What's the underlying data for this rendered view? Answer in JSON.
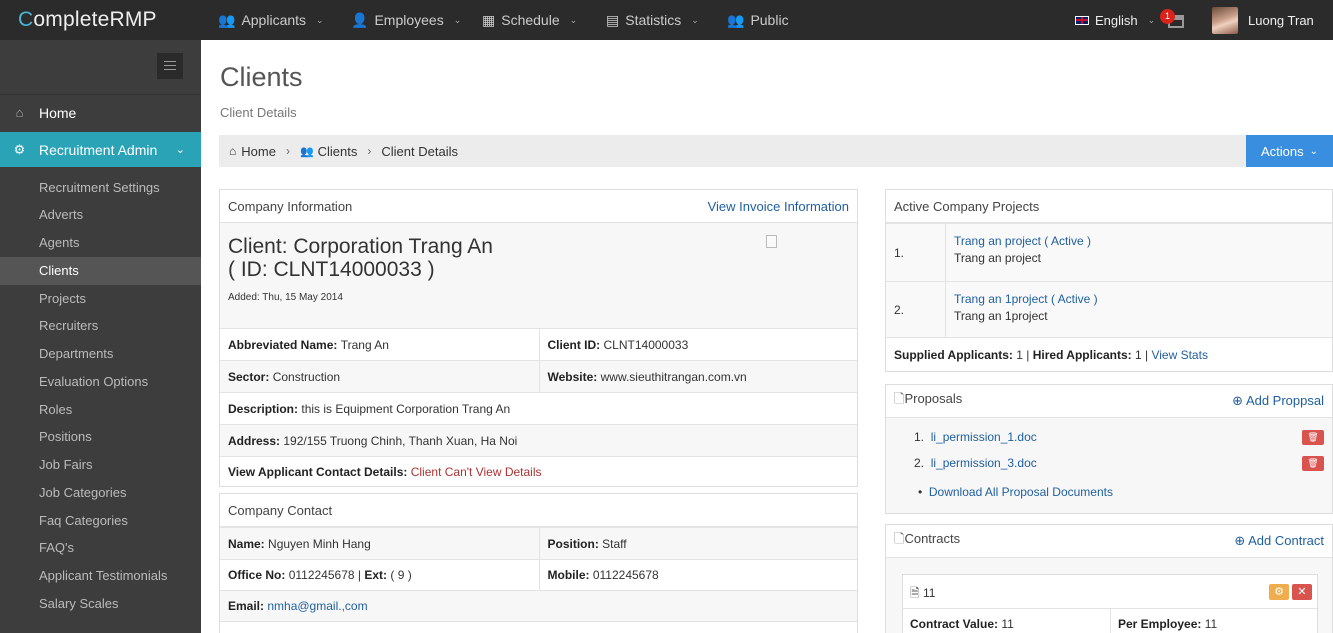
{
  "topbar": {
    "logo_prefix": "C",
    "logo_rest": "ompleteRMP",
    "nav": [
      "Applicants",
      "Employees",
      "Schedule",
      "Statistics",
      "Public"
    ],
    "language": "English",
    "notification_count": "1",
    "user_name": "Luong Tran"
  },
  "sidebar": {
    "home": "Home",
    "recruitment_admin": "Recruitment Admin",
    "items": [
      "Recruitment Settings",
      "Adverts",
      "Agents",
      "Clients",
      "Projects",
      "Recruiters",
      "Departments",
      "Evaluation Options",
      "Roles",
      "Positions",
      "Job Fairs",
      "Job Categories",
      "Faq Categories",
      "FAQ's",
      "Applicant Testimonials",
      "Salary Scales"
    ]
  },
  "page": {
    "title": "Clients",
    "subtitle": "Client Details",
    "breadcrumb": [
      "Home",
      "Clients",
      "Client Details"
    ],
    "actions": "Actions"
  },
  "company": {
    "header": "Company Information",
    "invoice_link": "View Invoice Information",
    "client_line1": "Client: Corporation Trang An",
    "client_line2": "( ID: CLNT14000033 )",
    "added": "Added: Thu, 15 May 2014",
    "abbr_label": "Abbreviated Name:",
    "abbr_value": "Trang An",
    "client_id_label": "Client ID:",
    "client_id_value": "CLNT14000033",
    "sector_label": "Sector:",
    "sector_value": "Construction",
    "website_label": "Website:",
    "website_value": "www.sieuthitrangan.com.vn",
    "desc_label": "Description:",
    "desc_value": "this is Equipment Corporation Trang An",
    "address_label": "Address:",
    "address_value": "192/155 Truong Chinh, Thanh Xuan, Ha Noi",
    "contact_details_label": "View Applicant Contact Details:",
    "contact_details_value": "Client Can't View Details"
  },
  "contact": {
    "header": "Company Contact",
    "name_label": "Name:",
    "name_value": "Nguyen Minh Hang",
    "position_label": "Position:",
    "position_value": "Staff",
    "office_label": "Office No:",
    "office_value": "0112245678",
    "ext_label": "Ext:",
    "ext_value": "( 9 )",
    "mobile_label": "Mobile:",
    "mobile_value": "0112245678",
    "email_label": "Email:",
    "email_value": "nmha@gmail.,com"
  },
  "projects": {
    "header": "Active Company Projects",
    "list": [
      {
        "num": "1.",
        "link": "Trang an project ( Active )",
        "name": "Trang an project"
      },
      {
        "num": "2.",
        "link": "Trang an 1project ( Active )",
        "name": "Trang an 1project"
      }
    ],
    "supplied_label": "Supplied Applicants:",
    "supplied_value": "1",
    "hired_label": "Hired Applicants:",
    "hired_value": "1",
    "view_stats": "View Stats"
  },
  "proposals": {
    "header": "Proposals",
    "add": "Add Proppsal",
    "files": [
      "li_permission_1.doc",
      "li_permission_3.doc"
    ],
    "download_all": "Download All Proposal Documents"
  },
  "contracts": {
    "header": "Contracts",
    "add": "Add Contract",
    "item_title": "11",
    "value_label": "Contract Value:",
    "value": "11",
    "per_employee_label": "Per Employee:",
    "per_employee": "11"
  },
  "colors": {
    "accent": "#2aa3b6",
    "actions_button": "#3a8ee0",
    "delete_button": "#d9534f",
    "warning_button": "#f0ad4e"
  }
}
